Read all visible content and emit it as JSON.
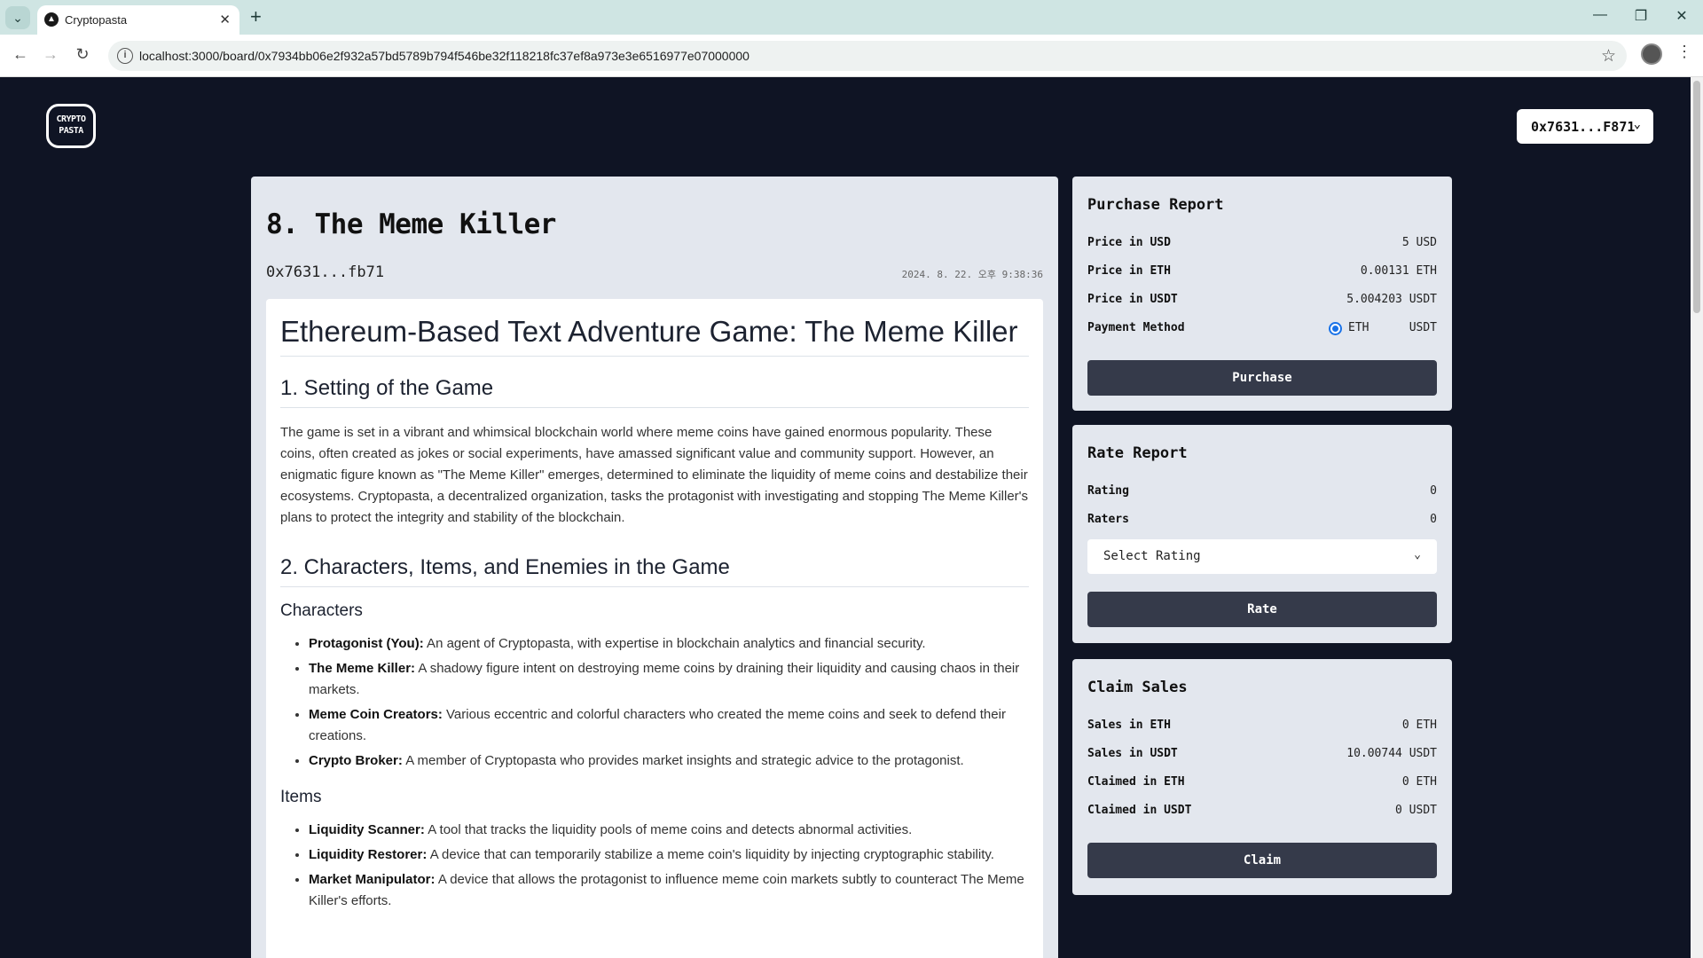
{
  "browser": {
    "tab_title": "Cryptopasta",
    "url": "localhost:3000/board/0x7934bb06e2f932a57bd5789b794f546be32f118218fc37ef8a973e3e6516977e07000000"
  },
  "header": {
    "logo_text": "CRYPTO PASTA",
    "wallet_label": "0x7631...F871"
  },
  "article": {
    "title": "8. The Meme Killer",
    "author": "0x7631...fb71",
    "date": "2024. 8. 22. 오후 9:38:36",
    "h1": "Ethereum-Based Text Adventure Game: The Meme Killer",
    "section1_title": "1. Setting of the Game",
    "section1_text": "The game is set in a vibrant and whimsical blockchain world where meme coins have gained enormous popularity. These coins, often created as jokes or social experiments, have amassed significant value and community support. However, an enigmatic figure known as \"The Meme Killer\" emerges, determined to eliminate the liquidity of meme coins and destabilize their ecosystems. Cryptopasta, a decentralized organization, tasks the protagonist with investigating and stopping The Meme Killer's plans to protect the integrity and stability of the blockchain.",
    "section2_title": "2. Characters, Items, and Enemies in the Game",
    "characters_title": "Characters",
    "characters": [
      {
        "name": "Protagonist (You):",
        "desc": " An agent of Cryptopasta, with expertise in blockchain analytics and financial security."
      },
      {
        "name": "The Meme Killer:",
        "desc": " A shadowy figure intent on destroying meme coins by draining their liquidity and causing chaos in their markets."
      },
      {
        "name": "Meme Coin Creators:",
        "desc": " Various eccentric and colorful characters who created the meme coins and seek to defend their creations."
      },
      {
        "name": "Crypto Broker:",
        "desc": " A member of Cryptopasta who provides market insights and strategic advice to the protagonist."
      }
    ],
    "items_title": "Items",
    "items": [
      {
        "name": "Liquidity Scanner:",
        "desc": " A tool that tracks the liquidity pools of meme coins and detects abnormal activities."
      },
      {
        "name": "Liquidity Restorer:",
        "desc": " A device that can temporarily stabilize a meme coin's liquidity by injecting cryptographic stability."
      },
      {
        "name": "Market Manipulator:",
        "desc": " A device that allows the protagonist to influence meme coin markets subtly to counteract The Meme Killer's efforts."
      }
    ]
  },
  "purchase": {
    "title": "Purchase Report",
    "price_usd_label": "Price in USD",
    "price_usd_value": "5 USD",
    "price_eth_label": "Price in ETH",
    "price_eth_value": "0.00131 ETH",
    "price_usdt_label": "Price in USDT",
    "price_usdt_value": "5.004203 USDT",
    "payment_label": "Payment Method",
    "payment_eth": "ETH",
    "payment_usdt": "USDT",
    "button": "Purchase"
  },
  "rate": {
    "title": "Rate Report",
    "rating_label": "Rating",
    "rating_value": "0",
    "raters_label": "Raters",
    "raters_value": "0",
    "select_value": "Select Rating",
    "button": "Rate"
  },
  "claim": {
    "title": "Claim Sales",
    "sales_eth_label": "Sales in ETH",
    "sales_eth_value": "0 ETH",
    "sales_usdt_label": "Sales in USDT",
    "sales_usdt_value": "10.00744 USDT",
    "claimed_eth_label": "Claimed in ETH",
    "claimed_eth_value": "0 ETH",
    "claimed_usdt_label": "Claimed in USDT",
    "claimed_usdt_value": "0 USDT",
    "button": "Claim"
  },
  "icons": {
    "tab_dropdown": "⌄",
    "favicon": "▲",
    "close": "✕",
    "new_tab": "+",
    "minimize": "—",
    "restore": "❐",
    "back": "←",
    "forward": "→",
    "reload": "↻",
    "info": "i",
    "star": "☆",
    "kebab": "⋮",
    "chevron": "⌄"
  }
}
